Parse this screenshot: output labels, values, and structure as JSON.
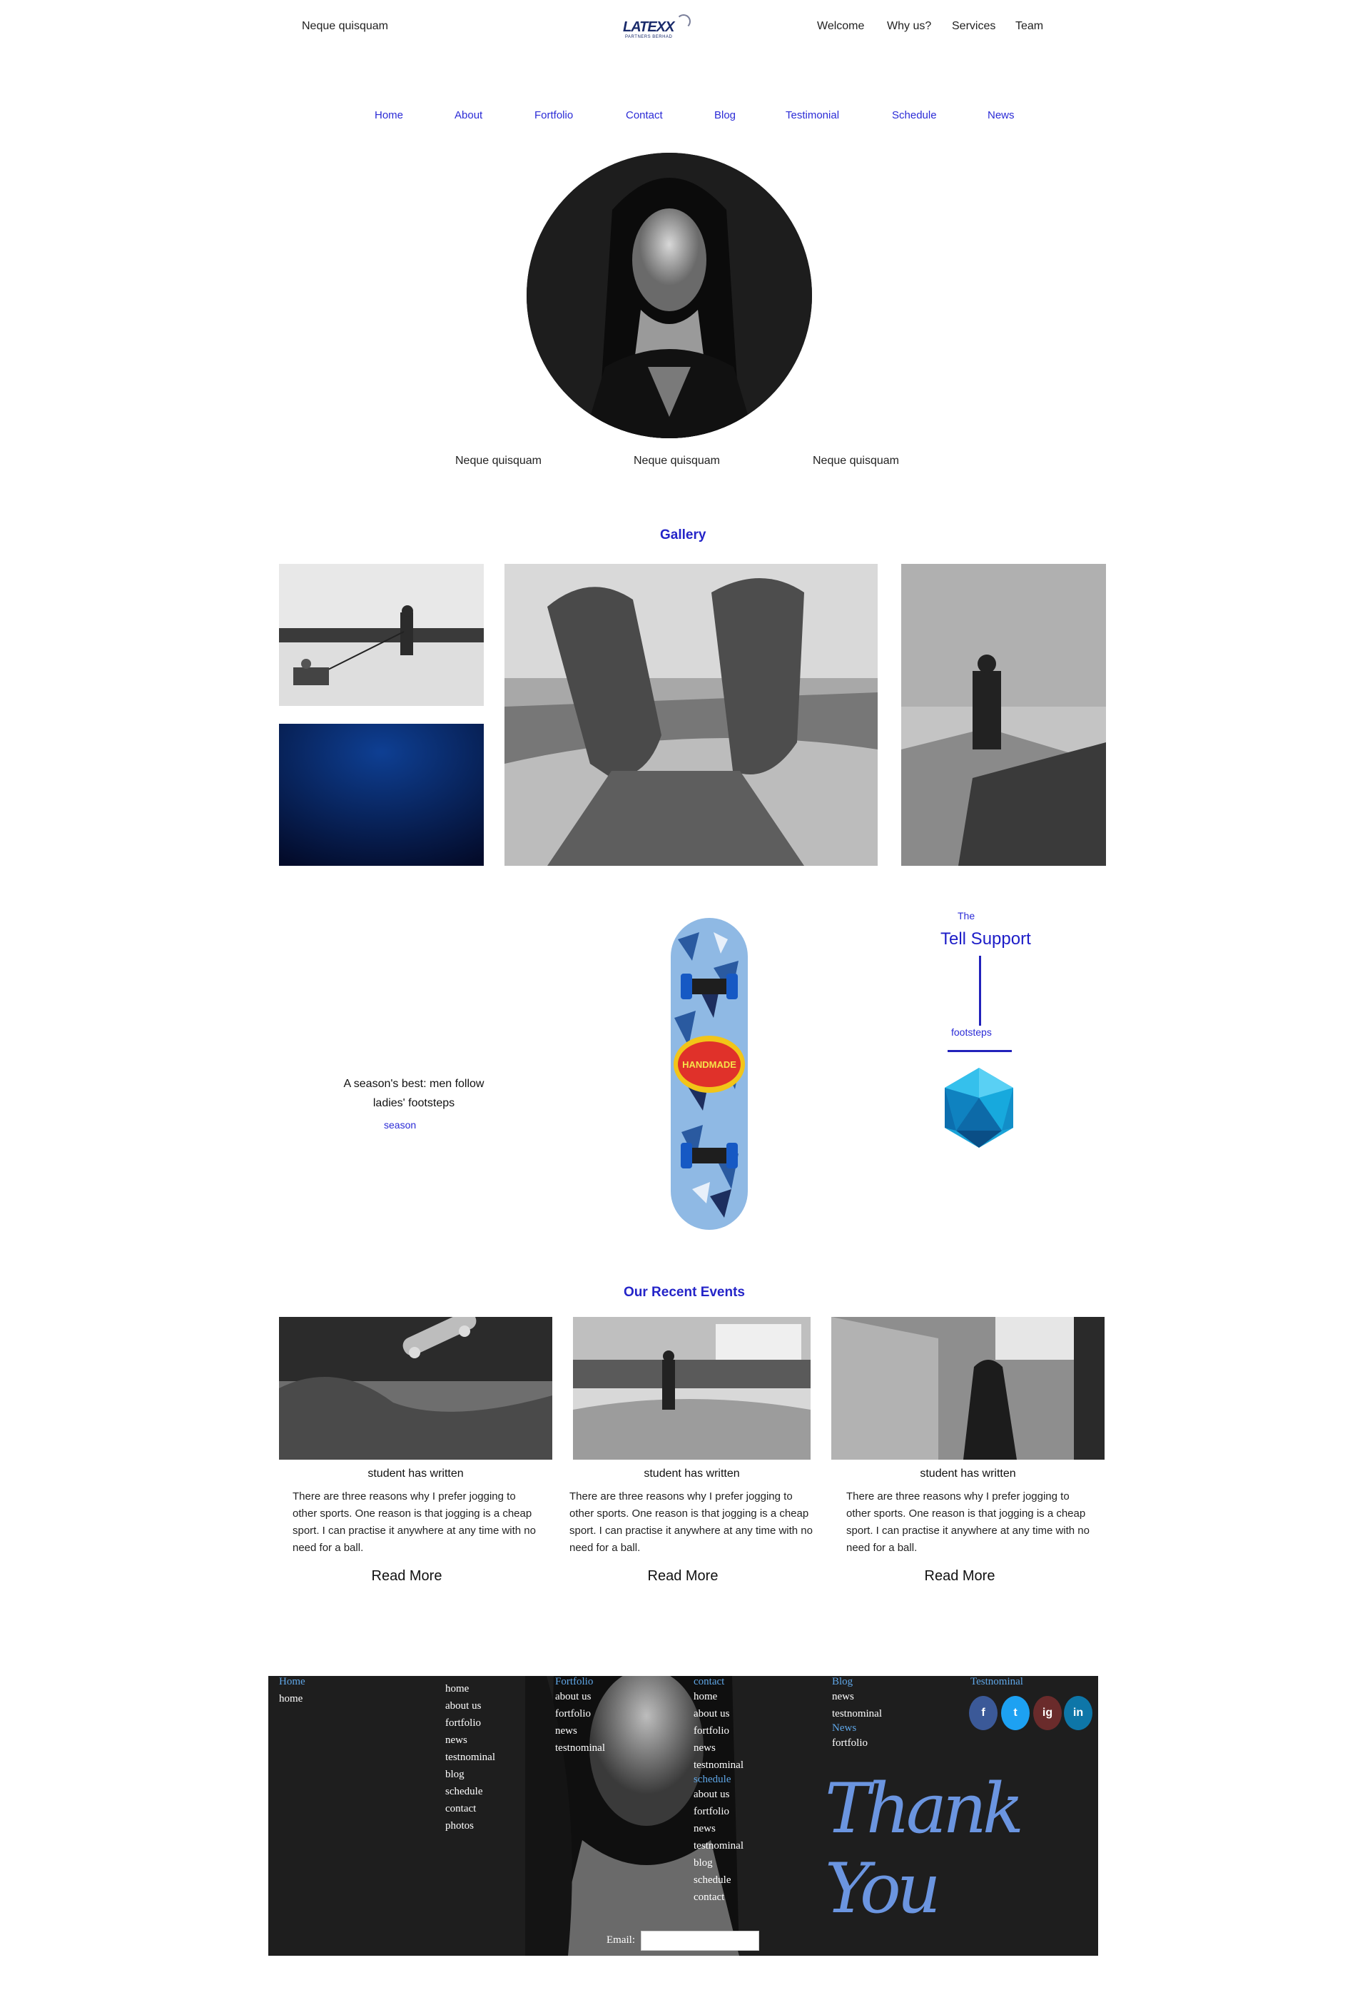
{
  "header": {
    "left_text": "Neque quisquam",
    "logo_text": "LATEXX",
    "logo_sub": "PARTNERS BERHAD",
    "links": [
      "Welcome",
      "Why us?",
      "Services",
      "Team"
    ]
  },
  "main_nav": [
    "Home",
    "About",
    "Fortfolio",
    "Contact",
    "Blog",
    "Testimonial",
    "Schedule",
    "News"
  ],
  "hero": {
    "captions": [
      "Neque quisquam",
      "Neque quisquam",
      "Neque quisquam"
    ]
  },
  "gallery": {
    "title": "Gallery"
  },
  "feature": {
    "text_line1": "A season's best: men follow",
    "text_line2": "ladies' footsteps",
    "season_link": "season",
    "skateboard_brand": "HANDMADE",
    "the_label": "The",
    "tell_support": "Tell Support",
    "footsteps": "footsteps"
  },
  "events": {
    "title": "Our Recent Events",
    "items": [
      {
        "heading": "student has written",
        "body": "There are three reasons why I prefer jogging to other sports. One reason is that jogging is a cheap sport. I can practise it anywhere at any time with no need for a ball.",
        "read_more": "Read More"
      },
      {
        "heading": "student has written",
        "body": "There are three reasons why I prefer jogging to other sports. One reason is that jogging is a cheap sport. I can practise it anywhere at any time with no need for a ball.",
        "read_more": "Read More"
      },
      {
        "heading": "student has written",
        "body": "There are three reasons why I prefer jogging to other sports. One reason is that jogging is a cheap sport. I can practise it anywhere at any time with no need for a ball.",
        "read_more": "Read More"
      }
    ]
  },
  "footer": {
    "col1": {
      "head": "Home",
      "items": [
        "home"
      ]
    },
    "col2": {
      "items": [
        "home",
        "about us",
        "fortfolio",
        "news",
        "testnominal",
        "blog",
        "schedule",
        "contact",
        "photos"
      ]
    },
    "col3": {
      "head": "Fortfolio",
      "items": [
        "about us",
        "fortfolio",
        "news",
        "testnominal"
      ]
    },
    "col4": {
      "head": "contact",
      "items": [
        "home",
        "about us",
        "fortfolio",
        "news",
        "testnominal"
      ],
      "head2": "schedule",
      "items2": [
        "about us",
        "fortfolio",
        "news",
        "testnominal",
        "blog",
        "schedule",
        "contact"
      ]
    },
    "col5": {
      "head": "Blog",
      "items": [
        "news",
        "testnominal"
      ],
      "head2": "News",
      "items2": [
        "fortfolio"
      ]
    },
    "col6": {
      "head": "Testnominal"
    },
    "social": [
      "f",
      "t",
      "ig",
      "in"
    ],
    "social_colors": [
      "#3b5998",
      "#1da1f2",
      "#6a2b2b",
      "#0e76a8"
    ],
    "thank_you": "Thank You",
    "email_label": "Email:",
    "email_value": ""
  }
}
